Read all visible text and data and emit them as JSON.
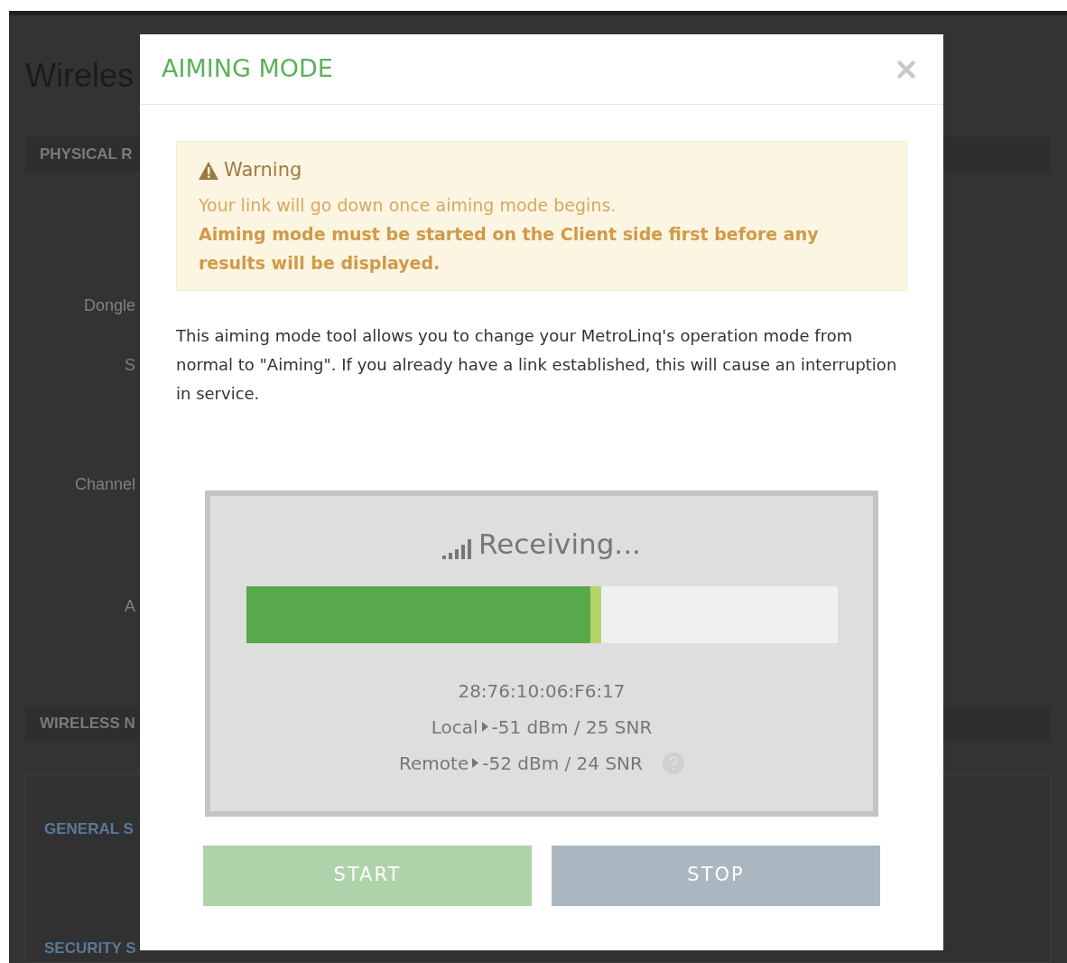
{
  "background": {
    "title": "Wireles",
    "items": [
      {
        "kind": "section",
        "text": "PHYSICAL R"
      },
      {
        "kind": "label",
        "text": "Dongle"
      },
      {
        "kind": "label",
        "text": "S"
      },
      {
        "kind": "label",
        "text": "Channel"
      },
      {
        "kind": "label",
        "text": "A"
      },
      {
        "kind": "section",
        "text": "WIRELESS N"
      },
      {
        "kind": "card_heading",
        "text": "GENERAL S"
      },
      {
        "kind": "card_heading",
        "text": "SECURITY S"
      }
    ]
  },
  "dialog": {
    "title": "AIMING MODE",
    "warning": {
      "title": "Warning",
      "lines": [
        {
          "text": "Your link will go down once aiming mode begins.",
          "bold": false
        },
        {
          "text": "Aiming mode must be started on the Client side first before any results will be displayed.",
          "bold": true
        }
      ]
    },
    "description": "This aiming mode tool allows you to change your MetroLinq's operation mode from normal to \"Aiming\". If you already have a link established, this will cause an interruption in service.",
    "status": "Receiving...",
    "signal": {
      "level": 0.6
    },
    "mac": "28:76:10:06:F6:17",
    "readings": [
      {
        "label": "Local",
        "value": "-51 dBm / 25 SNR",
        "help": false
      },
      {
        "label": "Remote",
        "value": "-52 dBm / 24 SNR",
        "help": true
      }
    ],
    "buttons": [
      {
        "label": "START",
        "kind": "start",
        "disabled": true
      },
      {
        "label": "STOP",
        "kind": "stop",
        "disabled": true
      }
    ]
  }
}
